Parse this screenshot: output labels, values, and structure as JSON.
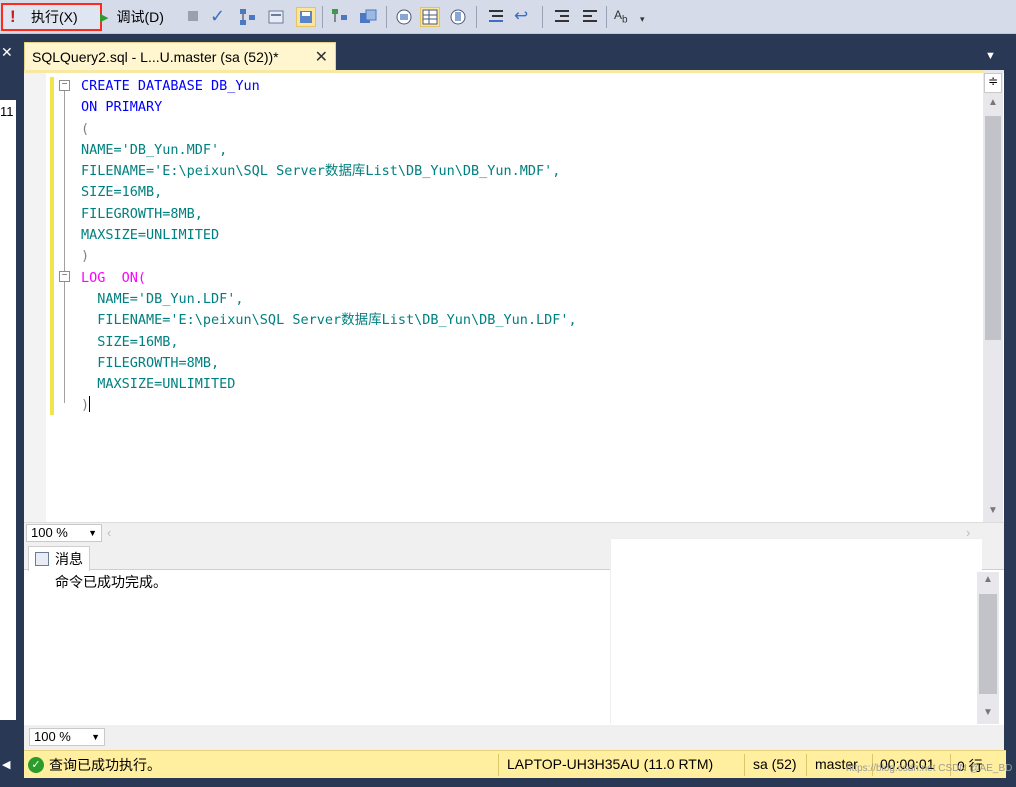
{
  "toolbar": {
    "execute_label": "执行(X)",
    "debug_label": "调试(D)"
  },
  "left_strip": {
    "close_glyph": "✕",
    "line_number": "11"
  },
  "document_tab": {
    "title": "SQLQuery2.sql - L...U.master (sa (52))*",
    "close_glyph": "✕"
  },
  "editor": {
    "lines": [
      "CREATE DATABASE DB_Yun",
      "ON PRIMARY",
      "(",
      "NAME='DB_Yun.MDF',",
      "FILENAME='E:\\peixun\\SQL Server数据库List\\DB_Yun\\DB_Yun.MDF',",
      "SIZE=16MB,",
      "FILEGROWTH=8MB,",
      "MAXSIZE=UNLIMITED",
      ")",
      "LOG  ON(",
      "  NAME='DB_Yun.LDF',",
      "  FILENAME='E:\\peixun\\SQL Server数据库List\\DB_Yun\\DB_Yun.LDF',",
      "  SIZE=16MB,",
      "  FILEGROWTH=8MB,",
      "  MAXSIZE=UNLIMITED",
      ")"
    ],
    "zoom": "100 %"
  },
  "results": {
    "tab_label": "消息",
    "message": "命令已成功完成。",
    "zoom": "100 %"
  },
  "status": {
    "message": "查询已成功执行。",
    "server": "LAPTOP-UH3H35AU (11.0 RTM)",
    "user": "sa (52)",
    "database": "master",
    "elapsed": "00:00:01",
    "rows": "0 行"
  },
  "watermark": "https://blog.csdn.net CSDN @AE_BD",
  "colors": {
    "keyword": "#0000ff",
    "function": "#008080",
    "string": "#e00000",
    "log_keyword": "#ff00ff",
    "highlight_border": "#ff2a1a",
    "status_bar": "#ffef9e"
  }
}
